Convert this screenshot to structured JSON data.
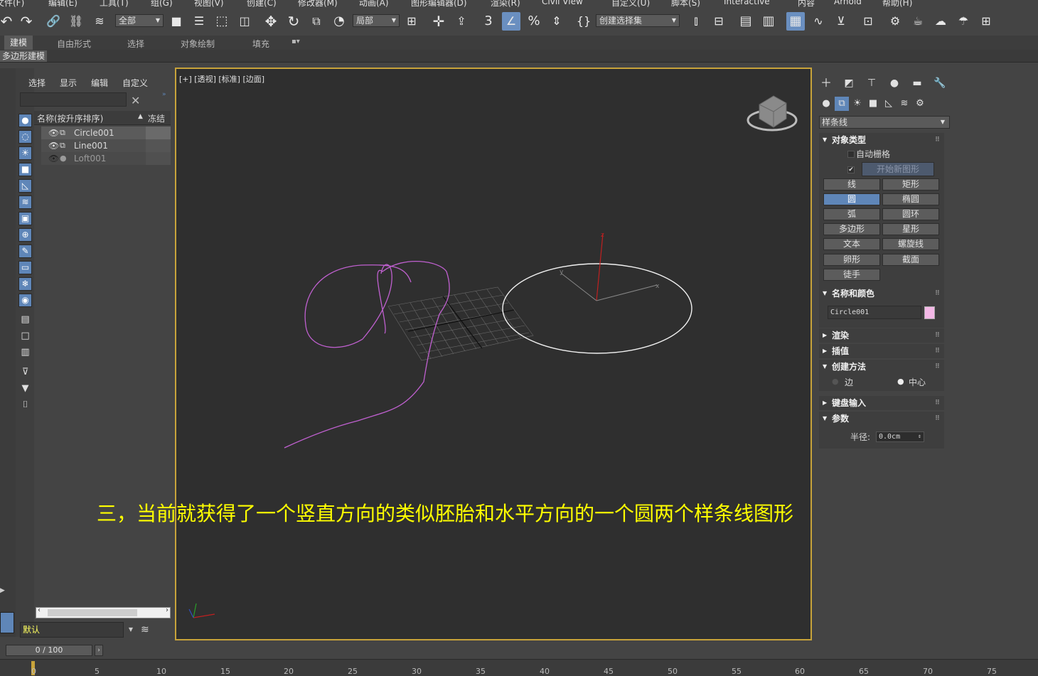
{
  "menu": [
    "文件(F)",
    "编辑(E)",
    "工具(T)",
    "组(G)",
    "视图(V)",
    "创建(C)",
    "修改器(M)",
    "动画(A)",
    "图形编辑器(D)",
    "渲染(R)",
    "Civil View",
    "自定义(U)",
    "脚本(S)",
    "Interactive",
    "内容",
    "Arnold",
    "帮助(H)"
  ],
  "toolbar": {
    "selection_filter": "全部",
    "ref_coord": "局部",
    "named_selection": "创建选择集"
  },
  "ribbon": {
    "tabs": [
      "建模",
      "自由形式",
      "选择",
      "对象绘制",
      "填充"
    ],
    "sub_label": "多边形建模"
  },
  "explorer": {
    "tabs": [
      "选择",
      "显示",
      "编辑",
      "自定义"
    ],
    "search_placeholder": "",
    "col_name": "名称(按升序排序)",
    "col_sort_icon": "▲",
    "col_frozen": "冻结",
    "rows": [
      {
        "name": "Circle001",
        "selected": true
      },
      {
        "name": "Line001",
        "selected": false
      },
      {
        "name": "Loft001",
        "selected": false
      }
    ],
    "layer": "默认"
  },
  "viewport": {
    "label": "[+] [透视] [标准] [边面]",
    "caption": "三，当前就获得了一个竖直方向的类似胚胎和水平方向的一个圆两个样条线图形"
  },
  "command_panel": {
    "category": "样条线",
    "object_type_title": "对象类型",
    "auto_grid": "自动栅格",
    "start_new_shape": "开始新图形",
    "buttons": [
      "线",
      "矩形",
      "圆",
      "椭圆",
      "弧",
      "圆环",
      "多边形",
      "星形",
      "文本",
      "螺旋线",
      "卵形",
      "截面",
      "徒手"
    ],
    "selected_button": "圆",
    "name_color_title": "名称和颜色",
    "object_name": "Circle001",
    "object_color": "#f3b8e6",
    "rollouts": [
      "渲染",
      "插值",
      "创建方法",
      "键盘输入",
      "参数"
    ],
    "creation_edge": "边",
    "creation_center": "中心",
    "radius_label": "半径:",
    "radius_value": "0.0cm"
  },
  "timeline": {
    "frame": "0 / 100",
    "ticks": [
      "0",
      "5",
      "10",
      "15",
      "20",
      "25",
      "30",
      "35",
      "40",
      "45",
      "50",
      "55",
      "60",
      "65",
      "70",
      "75"
    ]
  }
}
